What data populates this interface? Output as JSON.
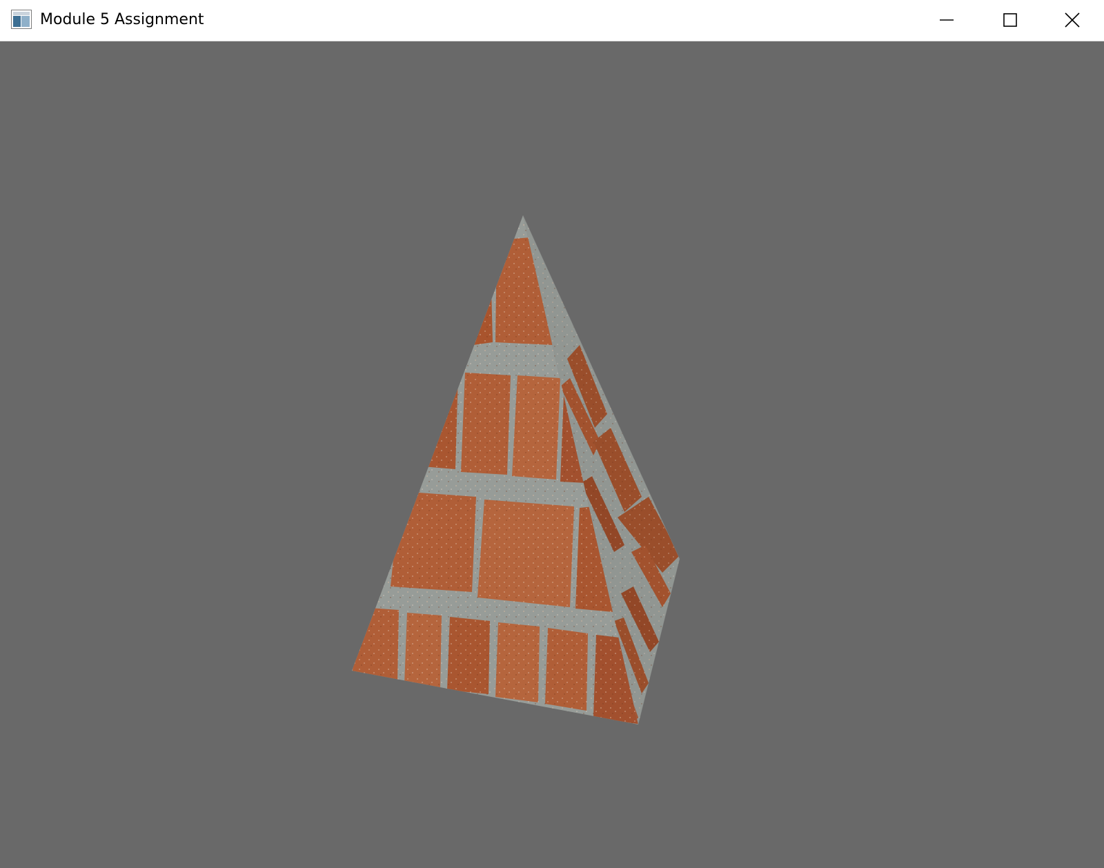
{
  "window": {
    "title": "Module 5 Assignment",
    "icons": {
      "app": "application-window-icon",
      "minimize": "minimize-icon",
      "maximize": "maximize-icon",
      "close": "close-icon"
    }
  },
  "viewport": {
    "background_color": "#696969",
    "object": "textured-pyramid",
    "texture": "brick-wall",
    "colors": {
      "brick": "#b8623a",
      "brick_dark": "#8f4526",
      "mortar": "#9ea39f"
    }
  }
}
